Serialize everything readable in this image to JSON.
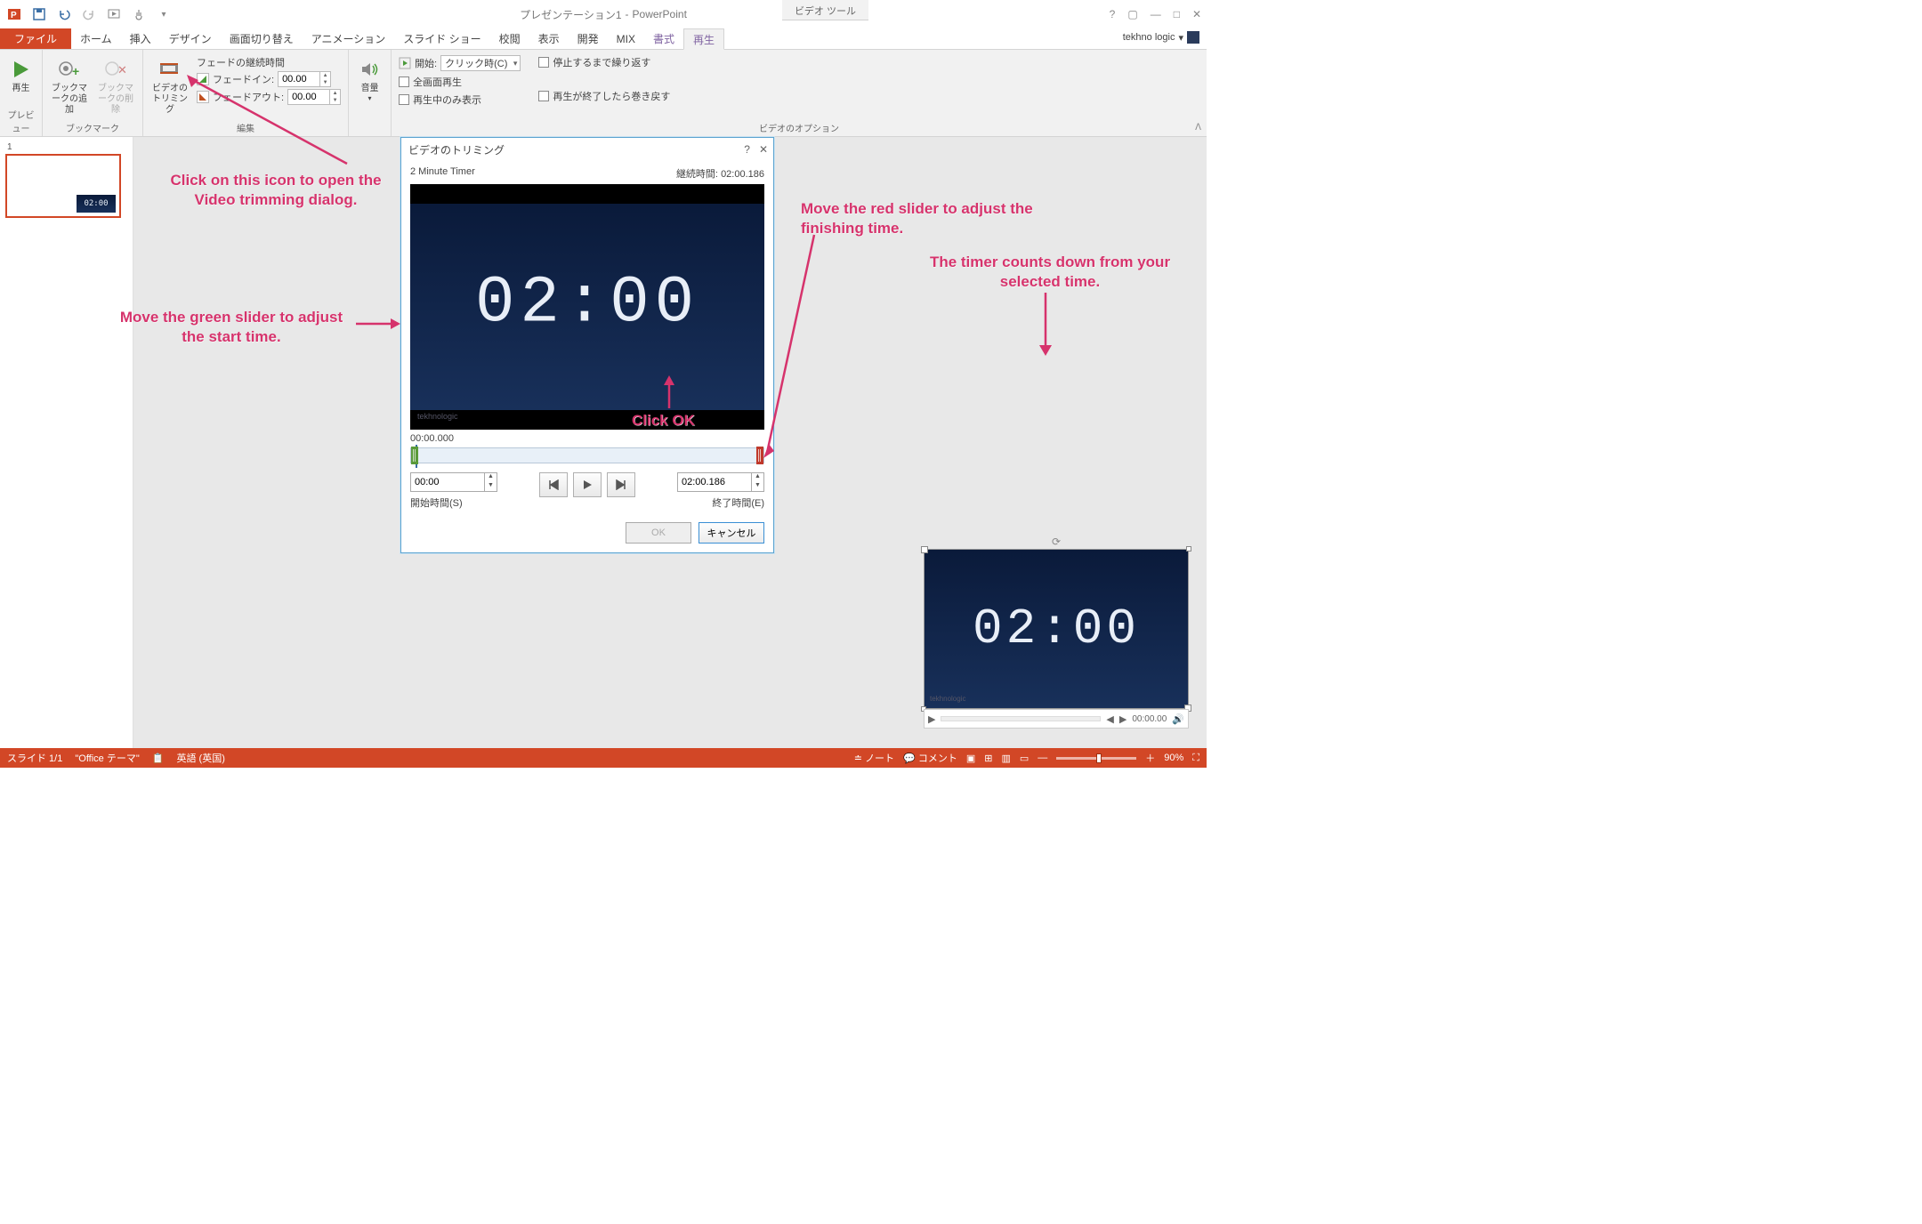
{
  "titlebar": {
    "title_doc": "プレゼンテーション1",
    "title_app": "PowerPoint",
    "context_tool": "ビデオ ツール"
  },
  "tabs": {
    "file": "ファイル",
    "home": "ホーム",
    "insert": "挿入",
    "design": "デザイン",
    "transitions": "画面切り替え",
    "animations": "アニメーション",
    "slideshow": "スライド ショー",
    "review": "校閲",
    "view": "表示",
    "developer": "開発",
    "mix": "MIX",
    "format": "書式",
    "playback": "再生",
    "user": "tekhno logic"
  },
  "ribbon": {
    "preview_group": "プレビュー",
    "play": "再生",
    "bookmark_group": "ブックマーク",
    "add_bookmark": "ブックマークの追加",
    "remove_bookmark": "ブックマークの削除",
    "edit_group": "編集",
    "trim_video": "ビデオのトリミング",
    "fade_title": "フェードの継続時間",
    "fade_in": "フェードイン:",
    "fade_out": "フェードアウト:",
    "fade_in_val": "00.00",
    "fade_out_val": "00.00",
    "volume": "音量",
    "options_group": "ビデオのオプション",
    "start_label": "開始:",
    "start_opt": "クリック時(C)",
    "fullscreen": "全画面再生",
    "hide_not_playing": "再生中のみ表示",
    "loop": "停止するまで繰り返す",
    "rewind": "再生が終了したら巻き戻す"
  },
  "slide": {
    "num": "1",
    "thumb_time": "02:00"
  },
  "dialog": {
    "title": "ビデオのトリミング",
    "video_name": "2 Minute Timer",
    "duration_label": "継続時間:",
    "duration": "02:00.186",
    "digits": "02:00",
    "logo": "tekhnologic",
    "time_pos": "00:00.000",
    "start_val": "00:00",
    "start_label": "開始時間(S)",
    "end_val": "02:00.186",
    "end_label": "終了時間(E)",
    "ok": "OK",
    "cancel": "キャンセル"
  },
  "slide_video": {
    "digits": "02:00",
    "logo": "tekhnologic",
    "media_time": "00:00.00"
  },
  "annotations": {
    "trim_icon": "Click on this icon to open the Video trimming dialog.",
    "green_slider": "Move the green slider to adjust the start time.",
    "red_slider": "Move the red slider to adjust the finishing time.",
    "countdown": "The timer counts down from your selected time.",
    "click_ok": "Click OK"
  },
  "status": {
    "slide": "スライド 1/1",
    "theme": "\"Office テーマ\"",
    "lang": "英語 (英国)",
    "notes": "ノート",
    "comments": "コメント",
    "zoom": "90%"
  }
}
